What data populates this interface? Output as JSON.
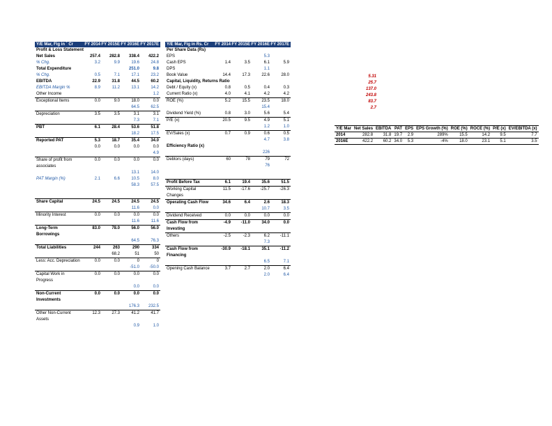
{
  "years": [
    "FY 2014",
    "FY 2015E",
    "FY 2016E",
    "FY 2017E"
  ],
  "left": {
    "title": "Y/E Mar, Fig in ` Cr",
    "rows": [
      {
        "lab": "Profit & Loss Statement",
        "b": 1
      },
      {
        "lab": "Net Sales",
        "b": 1,
        "v": [
          "257.4",
          "282.8",
          "338.4",
          "422.2"
        ]
      },
      {
        "lab": "% Chg.",
        "it": 1,
        "blue": 1,
        "v": [
          "3.2",
          "9.9",
          "19.6",
          "24.8"
        ]
      },
      {
        "lab": "Total Expenditure",
        "b": 1,
        "v": [
          "",
          "",
          "251.0",
          "9.8"
        ],
        "vb": [
          2,
          3
        ]
      },
      {
        "lab": "% Chg.",
        "it": 1,
        "blue": 1,
        "v": [
          "0.5",
          "7.1",
          "17.1",
          "23.2"
        ]
      },
      {
        "lab": "EBITDA",
        "b": 1,
        "v": [
          "22.9",
          "31.8",
          "44.5",
          "60.2"
        ]
      },
      {
        "lab": "EBITDA Margin %",
        "it": 1,
        "blue": 1,
        "v": [
          "8.9",
          "11.2",
          "13.1",
          "14.2"
        ]
      },
      {
        "lab": "Other Income",
        "v": [
          "",
          "",
          "",
          "1.2"
        ],
        "vb": [
          3
        ]
      },
      {
        "lab": "Exceptional Items",
        "v": [
          "0.0",
          "9.0",
          "18.0",
          "0.0"
        ],
        "rule": 1
      },
      {
        "lab": "",
        "blue": 1,
        "v": [
          "",
          "",
          "64.5",
          "62.5"
        ]
      },
      {
        "lab": "Depreciation",
        "v": [
          "3.5",
          "3.5",
          "3.1",
          "3.1"
        ],
        "rule": 1
      },
      {
        "lab": "",
        "blue": 1,
        "v": [
          "",
          "",
          "7.3",
          "7.1"
        ]
      },
      {
        "lab": "PBT",
        "b": 1,
        "v": [
          "6.1",
          "28.4",
          "53.6",
          "51.8"
        ],
        "rule": 1
      },
      {
        "lab": "",
        "blue": 1,
        "v": [
          "",
          "",
          "18.2",
          "17.5"
        ]
      },
      {
        "lab": "Reported PAT",
        "b": 1,
        "v": [
          "5.3",
          "18.7",
          "35.4",
          "34.0"
        ],
        "rule": 1
      },
      {
        "lab": "",
        "v": [
          "0.0",
          "0.0",
          "0.0",
          "0.0"
        ]
      },
      {
        "lab": "",
        "blue": 1,
        "v": [
          "",
          "",
          "",
          "4.9"
        ]
      },
      {
        "lab": "Share of profit from associates",
        "v": [
          "0.0",
          "0.0",
          "0.0",
          "0.0"
        ],
        "rule": 1
      },
      {
        "lab": "",
        "blue": 1,
        "v": [
          "",
          "",
          "13.1",
          "14.0"
        ]
      },
      {
        "lab": "PAT Margin (%)",
        "it": 1,
        "blue": 1,
        "v": [
          "2.1",
          "6.6",
          "10.5",
          "8.0"
        ]
      },
      {
        "lab": "",
        "blue": 1,
        "v": [
          "",
          "",
          "58.3",
          "57.5"
        ]
      }
    ],
    "rows2": [
      {
        "lab": "Share Capital",
        "b": 1,
        "v": [
          "24.5",
          "24.5",
          "24.5",
          "24.5"
        ],
        "rule": 1
      },
      {
        "lab": "",
        "blue": 1,
        "v": [
          "",
          "",
          "11.6",
          "0.0"
        ]
      },
      {
        "lab": "Minority Interest",
        "v": [
          "0.0",
          "0.0",
          "0.0",
          "0.0"
        ],
        "rule": 1
      },
      {
        "lab": "",
        "blue": 1,
        "v": [
          "",
          "",
          "11.6",
          "11.6"
        ]
      },
      {
        "lab": "Long-Term Borrowings",
        "b": 1,
        "v": [
          "83.0",
          "78.0",
          "56.0",
          "56.0"
        ],
        "rule": 1
      },
      {
        "lab": "",
        "blue": 1,
        "v": [
          "",
          "",
          "64.5",
          "76.3"
        ]
      },
      {
        "lab": "Total Liabilities",
        "b": 1,
        "v": [
          "244",
          "263",
          "290",
          "334"
        ],
        "rule": 1
      },
      {
        "lab": "",
        "v": [
          "",
          "68.2",
          "51",
          "50"
        ]
      },
      {
        "lab": "Less: Acc. Depreciation",
        "v": [
          "0.0",
          "0.0",
          "0",
          "0"
        ],
        "rule": 1
      },
      {
        "lab": "",
        "blue": 1,
        "v": [
          "",
          "",
          "-51.0",
          "-50.0"
        ]
      },
      {
        "lab": "Capital Work in Progress",
        "v": [
          "0.0",
          "0.0",
          "0.0",
          "0.0"
        ],
        "rule": 1
      },
      {
        "lab": "",
        "blue": 1,
        "v": [
          "",
          "",
          "0.0",
          "0.0"
        ]
      },
      {
        "lab": "Non-Current Investments",
        "b": 1,
        "v": [
          "0.0",
          "0.0",
          "0.0",
          "0.0"
        ],
        "rule": 1
      },
      {
        "lab": "",
        "blue": 1,
        "v": [
          "",
          "",
          "176.3",
          "232.5"
        ]
      },
      {
        "lab": "Other Non-Current Assets",
        "v": [
          "12.3",
          "27.3",
          "41.2",
          "41.7"
        ],
        "rule": 1
      },
      {
        "lab": "",
        "blue": 1,
        "v": [
          "",
          "",
          "0.9",
          "1.0"
        ]
      }
    ]
  },
  "right": {
    "title": "Y/E Mar, Fig in Rs. Cr",
    "rows": [
      {
        "lab": "Per Share Data (Rs)",
        "b": 1
      },
      {
        "lab": "EPS",
        "v": [
          "",
          "",
          "5.3",
          ""
        ],
        "vb": [
          2
        ]
      },
      {
        "lab": "Cash EPS",
        "v": [
          "1.4",
          "3.5",
          "6.1",
          "5.9"
        ]
      },
      {
        "lab": "DPS",
        "v": [
          "",
          "",
          "1.1",
          ""
        ],
        "vb": [
          2
        ]
      },
      {
        "lab": "Book Value",
        "v": [
          "14.4",
          "17.3",
          "22.6",
          "28.0"
        ]
      },
      {
        "lab": "Capital, Liquidity, Returns Ratio",
        "b": 1
      },
      {
        "lab": "Debt / Equity (x)",
        "v": [
          "0.8",
          "0.5",
          "0.4",
          "0.3"
        ]
      },
      {
        "lab": "Current Ratio (x)",
        "v": [
          "4.0",
          "4.1",
          "4.2",
          "4.2"
        ]
      },
      {
        "lab": "ROE (%)",
        "v": [
          "5.2",
          "15.5",
          "23.5",
          "18.0"
        ],
        "rule": 1
      },
      {
        "lab": "",
        "blue": 1,
        "v": [
          "",
          "",
          "15.4",
          ""
        ]
      },
      {
        "lab": "Dividend Yield (%)",
        "v": [
          "0.8",
          "3.0",
          "5.6",
          "5.4"
        ]
      },
      {
        "lab": "P/E (x)",
        "v": [
          "20.5",
          "9.5",
          "4.9",
          "5.1"
        ],
        "rule": 1
      },
      {
        "lab": "",
        "blue": 1,
        "v": [
          "",
          "",
          "1.2",
          "1.0"
        ]
      },
      {
        "lab": "EV/Sales (x)",
        "v": [
          "0.7",
          "0.9",
          "0.6",
          "0.5"
        ],
        "rule": 1
      },
      {
        "lab": "",
        "blue": 1,
        "v": [
          "",
          "",
          "4.7",
          "3.8"
        ]
      },
      {
        "lab": "Efficiency Ratio (x)",
        "b": 1
      },
      {
        "lab": "",
        "blue": 1,
        "v": [
          "",
          "",
          "226",
          ""
        ]
      },
      {
        "lab": "Debtors (days)",
        "v": [
          "60",
          "78",
          "79",
          "72"
        ],
        "rule": 1
      },
      {
        "lab": "",
        "blue": 1,
        "v": [
          "",
          "",
          "76",
          ""
        ]
      }
    ],
    "rows2": [
      {
        "lab": "Profit Before Tax",
        "b": 1,
        "v": [
          "6.1",
          "19.4",
          "35.6",
          "51.5"
        ],
        "rule": 1
      },
      {
        "lab": "",
        "v": [
          "",
          "",
          "",
          ""
        ]
      },
      {
        "lab": "Working Capital Changes",
        "v": [
          "11.5",
          "-17.6",
          "-25.7",
          "-26.3"
        ],
        "rule": 1
      },
      {
        "lab": "",
        "v": [
          "",
          "",
          "",
          ""
        ]
      },
      {
        "lab": "Operating Cash Flow",
        "b": 1,
        "v": [
          "34.6",
          "6.4",
          "2.6",
          "18.3"
        ],
        "rule": 1
      },
      {
        "lab": "",
        "blue": 1,
        "v": [
          "",
          "",
          "10.7",
          "3.5"
        ]
      },
      {
        "lab": "Dividend Received",
        "v": [
          "0.0",
          "0.0",
          "0.0",
          "0.0"
        ],
        "rule": 1
      },
      {
        "lab": "",
        "v": [
          "",
          "",
          "",
          ""
        ]
      },
      {
        "lab": "Cash Flow from Investing",
        "b": 1,
        "v": [
          "-4.9",
          "-11.0",
          "34.0",
          "0.0"
        ],
        "rule": 1
      },
      {
        "lab": "",
        "v": [
          "",
          "",
          "",
          ""
        ]
      },
      {
        "lab": "Others",
        "v": [
          "-2.5",
          "-2.3",
          "6.2",
          "-11.1"
        ],
        "rule": 1
      },
      {
        "lab": "",
        "blue": 1,
        "v": [
          "",
          "",
          "7.3",
          ""
        ]
      },
      {
        "lab": "Cash Flow from Financing",
        "b": 1,
        "v": [
          "-30.9",
          "-18.1",
          "35.1",
          "-11.2"
        ],
        "rule": 1
      },
      {
        "lab": "",
        "blue": 1,
        "v": [
          "",
          "",
          "6.5",
          "7.1"
        ]
      },
      {
        "lab": "Opening Cash Balance",
        "v": [
          "3.7",
          "2.7",
          "2.0",
          "6.4"
        ],
        "rule": 1
      },
      {
        "lab": "",
        "blue": 1,
        "v": [
          "",
          "",
          "2.0",
          "6.4"
        ]
      }
    ]
  },
  "side_red": [
    "5.31",
    "25.7",
    "137.0",
    "243.8",
    "83.7",
    "2.7"
  ],
  "summary": {
    "head": [
      "Y/E Mar",
      "Net Sales",
      "EBITDA",
      "PAT",
      "EPS",
      "EPS Growth (%)",
      "ROE (%)",
      "ROCE (%)",
      "P/E (x)",
      "EV/EBITDA (x)"
    ],
    "rows": [
      [
        "2014",
        "282.8",
        "31.8",
        "19.7",
        "2.9",
        "289%",
        "15.5",
        "14.2",
        "9.5",
        "7.7"
      ],
      [
        "2016E",
        "422.2",
        "60.2",
        "34.0",
        "5.3",
        "-4%",
        "18.0",
        "23.1",
        "5.1",
        "3.5"
      ]
    ]
  }
}
